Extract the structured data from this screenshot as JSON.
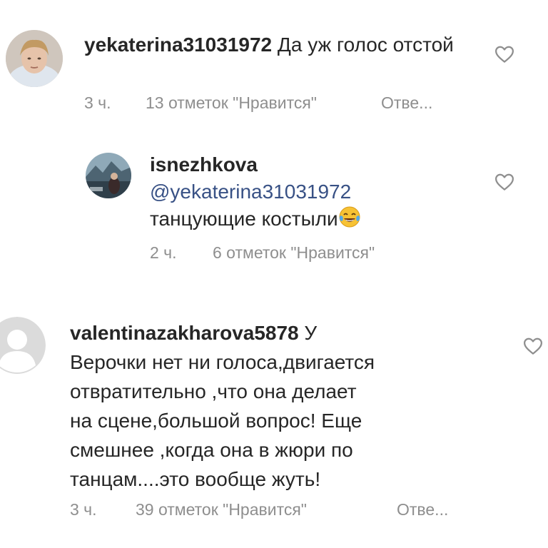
{
  "comments": [
    {
      "username": "yekaterina31031972",
      "text": " Да уж голос отстой",
      "time": "3 ч.",
      "likes": "13 отметок \"Нравится\"",
      "reply": "Отве...",
      "avatar": "photo-avatar-person"
    },
    {
      "username": "isnezhkova",
      "mention": "@yekaterina31031972",
      "text": "танцующие костыли",
      "emoji": "face-with-tears-of-joy",
      "time": "2 ч.",
      "likes": "6 отметок \"Нравится\"",
      "avatar": "photo-avatar-mountains"
    },
    {
      "username": "valentinazakharova5878",
      "text_line1": " У",
      "text_lines": [
        "Верочки нет ни голоса,двигается",
        "отвратительно ,что она делает",
        "на сцене,большой вопрос! Еще",
        "смешнее ,когда она в жюри по",
        "танцам....это вообще жуть!"
      ],
      "time": "3 ч.",
      "likes": "39 отметок \"Нравится\"",
      "reply": "Отве...",
      "avatar": "default-avatar"
    }
  ],
  "icons": {
    "like": "heart-outline-icon"
  },
  "colors": {
    "text": "#262626",
    "meta": "#8e8e8e",
    "mention": "#385185",
    "heart": "#8e8e8e"
  }
}
